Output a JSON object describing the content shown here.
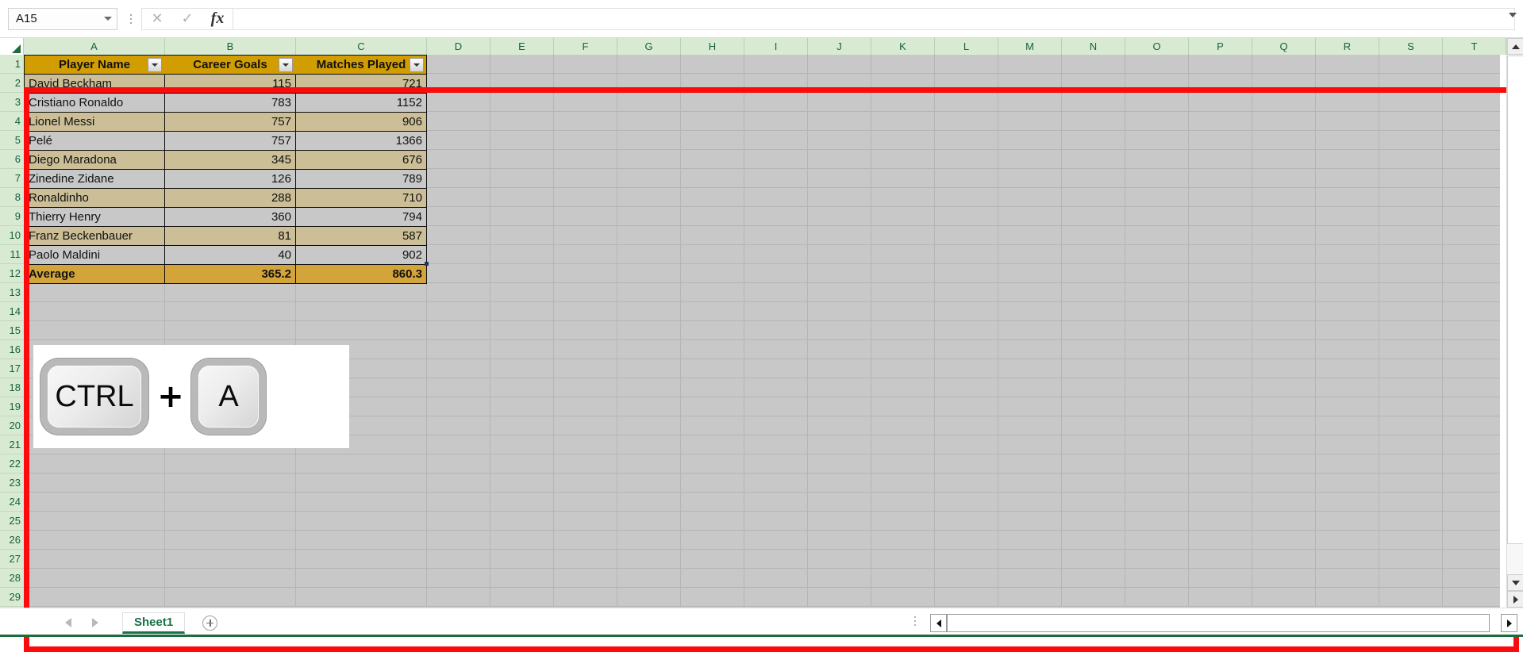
{
  "formula_bar": {
    "name_box_value": "A15",
    "cancel_icon": "close-icon",
    "confirm_icon": "check-icon",
    "function_icon": "fx-icon",
    "formula_value": "",
    "formula_placeholder": ""
  },
  "grid": {
    "column_letters": [
      "A",
      "B",
      "C",
      "D",
      "E",
      "F",
      "G",
      "H",
      "I",
      "J",
      "K",
      "L",
      "M",
      "N",
      "O",
      "P",
      "Q",
      "R",
      "S",
      "T"
    ],
    "row_numbers": [
      1,
      2,
      3,
      4,
      5,
      6,
      7,
      8,
      9,
      10,
      11,
      12,
      13,
      14,
      15,
      16,
      17,
      18,
      19,
      20,
      21,
      22,
      23,
      24,
      25,
      26,
      27,
      28,
      29
    ],
    "selected_cell": "A15"
  },
  "table": {
    "headers": [
      "Player Name",
      "Career Goals",
      "Matches Played"
    ],
    "rows": [
      {
        "player": "David Beckham",
        "goals": "115",
        "matches": "721"
      },
      {
        "player": "Cristiano Ronaldo",
        "goals": "783",
        "matches": "1152"
      },
      {
        "player": "Lionel Messi",
        "goals": "757",
        "matches": "906"
      },
      {
        "player": "Pelé",
        "goals": "757",
        "matches": "1366"
      },
      {
        "player": "Diego Maradona",
        "goals": "345",
        "matches": "676"
      },
      {
        "player": "Zinedine Zidane",
        "goals": "126",
        "matches": "789"
      },
      {
        "player": "Ronaldinho",
        "goals": "288",
        "matches": "710"
      },
      {
        "player": "Thierry Henry",
        "goals": "360",
        "matches": "794"
      },
      {
        "player": "Franz Beckenbauer",
        "goals": "81",
        "matches": "587"
      },
      {
        "player": "Paolo Maldini",
        "goals": "40",
        "matches": "902"
      }
    ],
    "total_row": {
      "label": "Average",
      "goals": "365.2",
      "matches": "860.3"
    },
    "colors": {
      "header_fill": "#d19d00",
      "banded_tan": "#ccbe96",
      "banded_gray": "#c8c8c8",
      "total_fill": "#d3a43a",
      "highlight_border": "#fb0b0b"
    }
  },
  "shortcut_image": {
    "key1": "CTRL",
    "separator": "+",
    "key2": "A"
  },
  "sheet_bar": {
    "prev_icon": "chevron-left-icon",
    "next_icon": "chevron-right-icon",
    "tab_label": "Sheet1",
    "add_sheet_icon": "plus-circle-icon",
    "hscroll_left_icon": "scroll-left-icon",
    "hscroll_right_icon": "scroll-right-icon"
  },
  "vertical_scrollbar": {
    "up_icon": "scroll-up-icon",
    "down_icon": "scroll-down-icon",
    "split_icon": "split-handle-icon"
  }
}
